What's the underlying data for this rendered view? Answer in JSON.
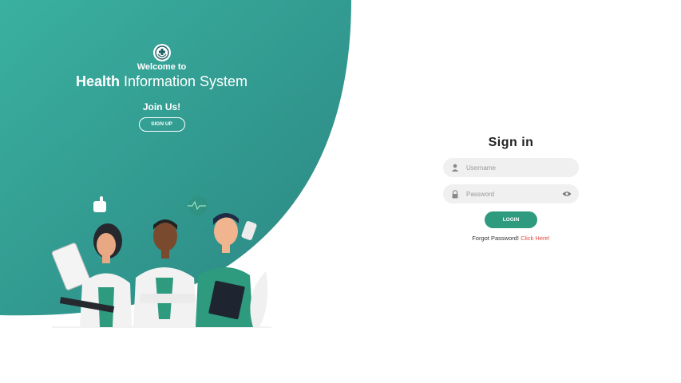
{
  "colors": {
    "hero_start": "#3ab0a0",
    "hero_end": "#2e8a84",
    "accent": "#2e9a7e",
    "link": "#e5483e"
  },
  "hero": {
    "logo_icon": "medical-cross-icon",
    "welcome": "Welcome to",
    "title_bold": "Health",
    "title_rest": " Information System",
    "join": "Join Us!",
    "signup_label": "SIGN UP"
  },
  "signin": {
    "title": "Sign in",
    "username_placeholder": "Username",
    "password_placeholder": "Password",
    "login_label": "LOGIN",
    "forgot_text": "Forgot Password! ",
    "click_here": "Click Here!"
  }
}
